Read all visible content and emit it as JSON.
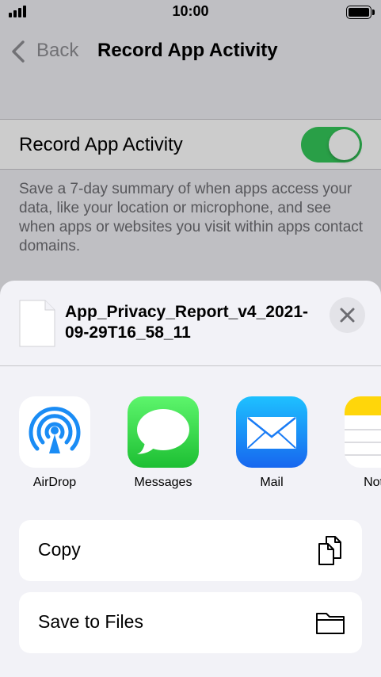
{
  "status_bar": {
    "time": "10:00"
  },
  "nav": {
    "back_label": "Back",
    "title": "Record App Activity"
  },
  "settings": {
    "toggle_label": "Record App Activity",
    "toggle_on": true,
    "footnote": "Save a 7-day summary of when apps access your data, like your location or microphone, and see when apps or websites you visit within apps contact domains."
  },
  "share_sheet": {
    "file_name": "App_Privacy_Report_v4_2021-09-29T16_58_11",
    "apps": [
      {
        "label": "AirDrop",
        "icon": "airdrop-icon"
      },
      {
        "label": "Messages",
        "icon": "messages-icon"
      },
      {
        "label": "Mail",
        "icon": "mail-icon"
      },
      {
        "label": "Notes",
        "icon": "notes-icon"
      }
    ],
    "actions": [
      {
        "label": "Copy",
        "icon": "copy-icon"
      },
      {
        "label": "Save to Files",
        "icon": "folder-icon"
      }
    ]
  },
  "colors": {
    "toggle_on": "#34c759",
    "airdrop_blue": "#1a8cf5",
    "messages_green": "#30d158",
    "mail_blue": "#1a7cf5"
  }
}
